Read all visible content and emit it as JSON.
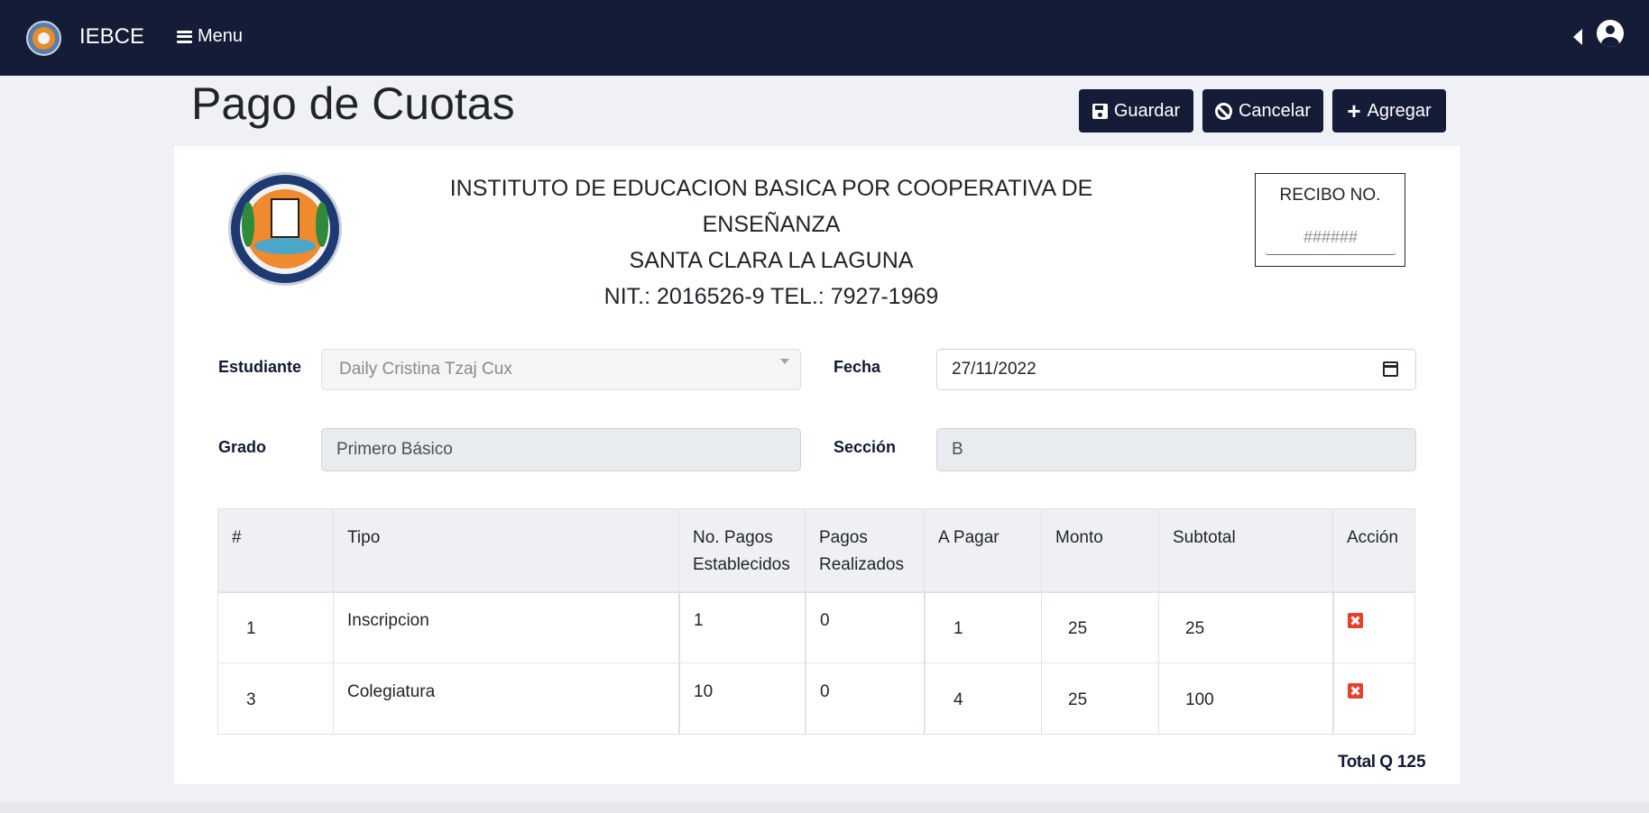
{
  "app": {
    "brand": "IEBCE",
    "menu_label": "Menu"
  },
  "page": {
    "title": "Pago de Cuotas"
  },
  "toolbar": {
    "save_label": "Guardar",
    "cancel_label": "Cancelar",
    "add_label": "Agregar"
  },
  "institution": {
    "line1": "INSTITUTO DE EDUCACION BASICA POR COOPERATIVA DE ENSEÑANZA",
    "line2": "SANTA CLARA LA LAGUNA",
    "line3": "NIT.: 2016526-9 TEL.: 7927-1969"
  },
  "receipt": {
    "label": "RECIBO NO.",
    "placeholder": "######"
  },
  "form": {
    "student_label": "Estudiante",
    "student_value": "Daily Cristina Tzaj Cux",
    "date_label": "Fecha",
    "date_value": "27/11/2022",
    "grade_label": "Grado",
    "grade_value": "Primero Básico",
    "section_label": "Sección",
    "section_value": "B"
  },
  "table": {
    "headers": {
      "num": "#",
      "tipo": "Tipo",
      "pagos_est_1": "No. Pagos",
      "pagos_est_2": "Establecidos",
      "pagos_real_1": "Pagos",
      "pagos_real_2": "Realizados",
      "a_pagar": "A Pagar",
      "monto": "Monto",
      "subtotal": "Subtotal",
      "accion": "Acción"
    },
    "rows": [
      {
        "num": "1",
        "tipo": "Inscripcion",
        "establecidos": "1",
        "realizados": "0",
        "a_pagar": "1",
        "monto": "25",
        "subtotal": "25"
      },
      {
        "num": "3",
        "tipo": "Colegiatura",
        "establecidos": "10",
        "realizados": "0",
        "a_pagar": "4",
        "monto": "25",
        "subtotal": "100"
      }
    ]
  },
  "total": {
    "label": "Total Q",
    "value": "125"
  },
  "colors": {
    "navbar": "#151c37",
    "page_bg": "#eff1f6",
    "danger": "#e8402c"
  }
}
